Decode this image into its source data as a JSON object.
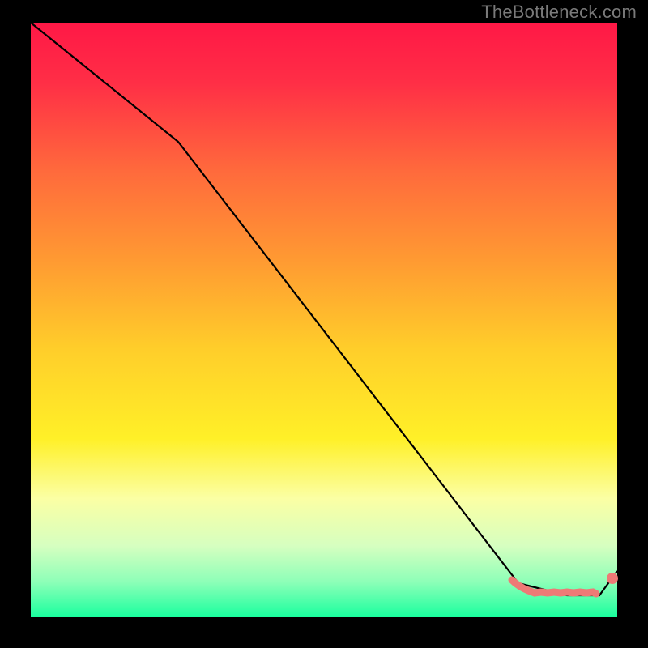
{
  "watermark": "TheBottleneck.com",
  "colors": {
    "gradient_top": "#ff1846",
    "gradient_mid": "#fff028",
    "gradient_bottom": "#19ff9e",
    "curve": "#000000",
    "markers": "#ee7a76",
    "frame": "#000000"
  },
  "chart_data": {
    "type": "line",
    "title": "",
    "xlabel": "",
    "ylabel": "",
    "xlim": [
      0,
      100
    ],
    "ylim": [
      0,
      100
    ],
    "grid": false,
    "legend": false,
    "note": "No axis ticks or numeric labels are rendered in the source image; x/y values are estimated from pixel positions on a 0–100 normalized scale.",
    "series": [
      {
        "name": "bottleneck-curve",
        "x": [
          0,
          25,
          83,
          91,
          97,
          100
        ],
        "y": [
          100,
          80,
          6,
          3,
          3,
          8
        ]
      }
    ],
    "markers": {
      "name": "highlighted-range",
      "color": "#ee7a76",
      "x": [
        82,
        83,
        84,
        85,
        86,
        87,
        88,
        89,
        90,
        91,
        92,
        93,
        94,
        95,
        96,
        99
      ],
      "y": [
        7,
        6,
        5,
        4,
        4,
        4,
        4,
        3,
        3,
        3,
        3,
        3,
        3,
        3,
        3,
        7
      ]
    }
  }
}
